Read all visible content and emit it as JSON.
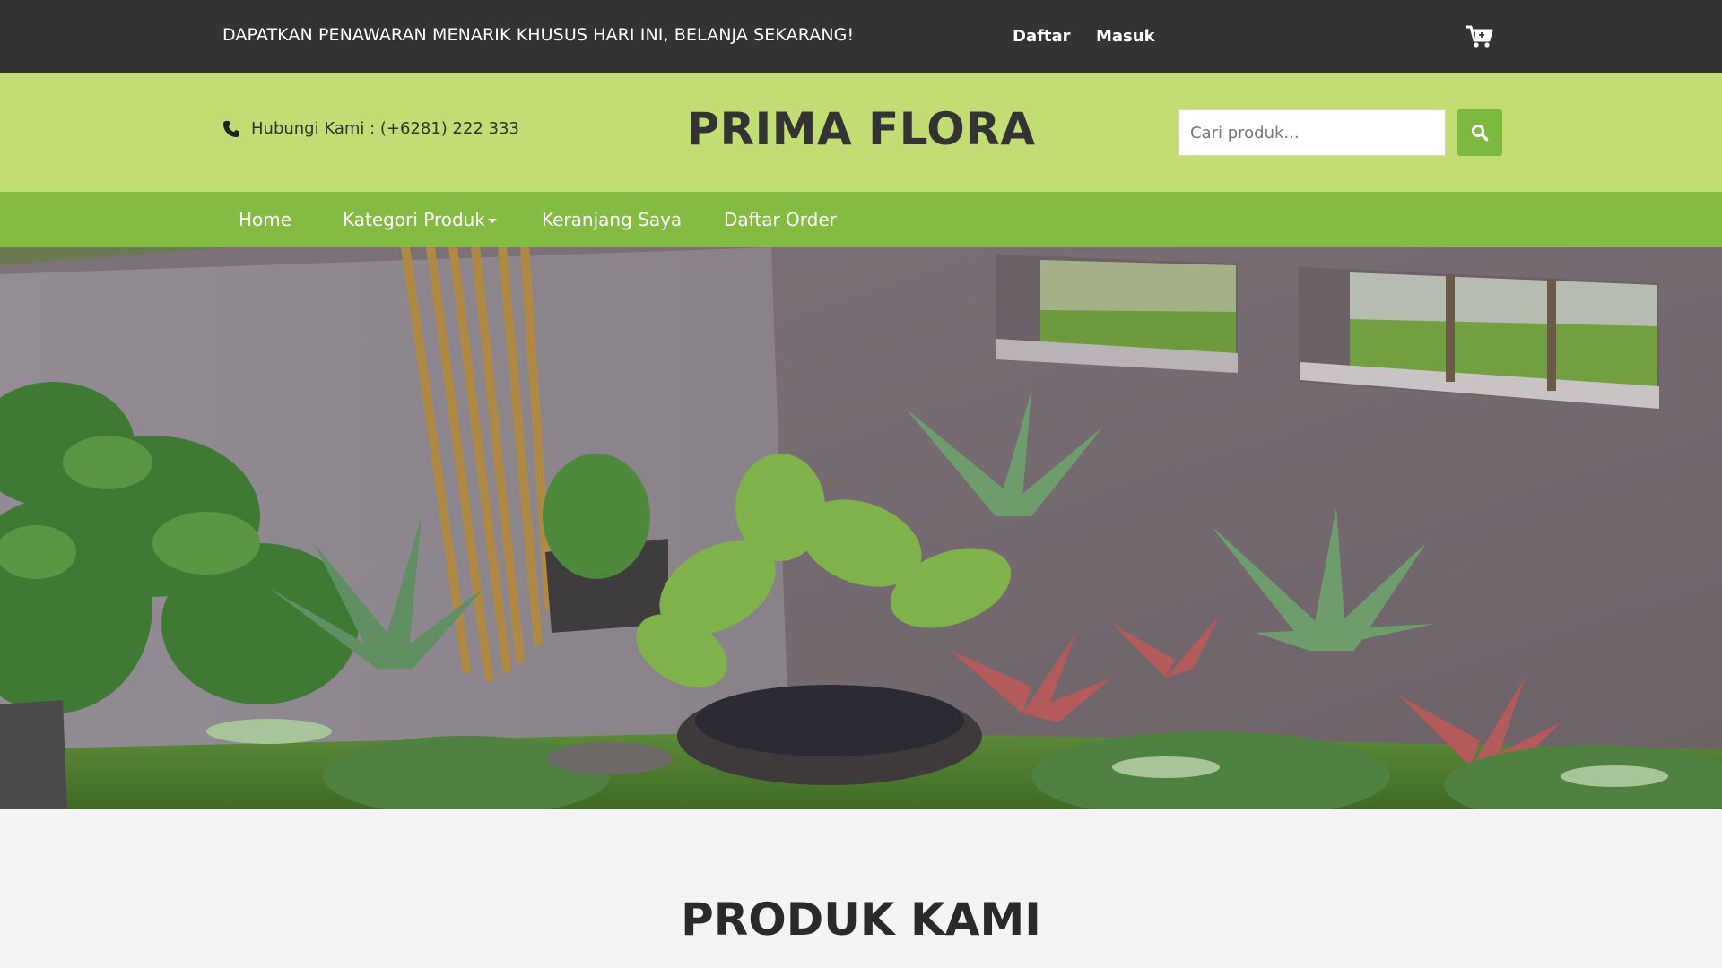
{
  "topbar": {
    "promo": "DAPATKAN PENAWARAN MENARIK KHUSUS HARI INI, BELANJA SEKARANG!",
    "register": "Daftar",
    "login": "Masuk",
    "cart_icon": "cart-icon"
  },
  "header": {
    "contact": "Hubungi Kami : (+6281) 222 333",
    "phone_icon": "phone-icon",
    "brand": "PRIMA FLORA",
    "search_placeholder": "Cari produk...",
    "search_icon": "search-icon"
  },
  "nav": {
    "items": [
      {
        "label": "Home"
      },
      {
        "label": "Kategori Produk",
        "dropdown": true
      },
      {
        "label": "Keranjang Saya"
      },
      {
        "label": "Daftar Order"
      }
    ]
  },
  "hero": {
    "image": "garden-photo"
  },
  "section": {
    "title": "PRODUK KAMI"
  },
  "colors": {
    "topbar": "#333333",
    "header": "#c2dd73",
    "nav": "#84bb42",
    "search_button": "#7db83f",
    "text_dark": "#333333"
  }
}
